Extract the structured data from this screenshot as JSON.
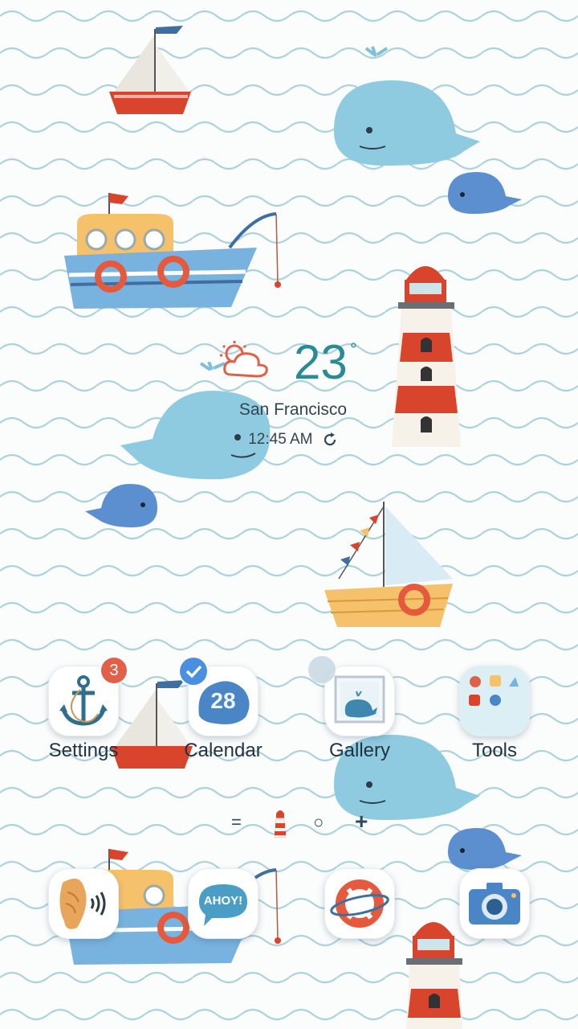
{
  "weather": {
    "temperature": "23",
    "degree_symbol": "°",
    "city": "San Francisco",
    "time": "12:45 AM",
    "icon": "partly-cloudy-icon"
  },
  "apps": [
    {
      "label": "Settings",
      "icon": "anchor-icon",
      "badge": "3"
    },
    {
      "label": "Calendar",
      "icon": "calendar-icon",
      "date": "28",
      "status": "checked"
    },
    {
      "label": "Gallery",
      "icon": "gallery-whale-icon"
    },
    {
      "label": "Tools",
      "icon": "folder-icon"
    }
  ],
  "pager": {
    "menu_glyph": "=",
    "dot_glyph": "○",
    "plus_glyph": "+",
    "current_page_icon": "lighthouse-icon"
  },
  "dock": [
    {
      "icon": "shell-phone-icon"
    },
    {
      "icon": "ahoy-message-icon",
      "text": "AHOY!"
    },
    {
      "icon": "lifebuoy-browser-icon"
    },
    {
      "icon": "camera-icon"
    }
  ],
  "colors": {
    "wave": "#9fcbd6",
    "accent": "#2a8a96",
    "red": "#d8452c",
    "whale": "#7fc0d8",
    "dark_whale": "#5b8fcf",
    "badge": "#e0604a",
    "check": "#4a8fe0"
  }
}
